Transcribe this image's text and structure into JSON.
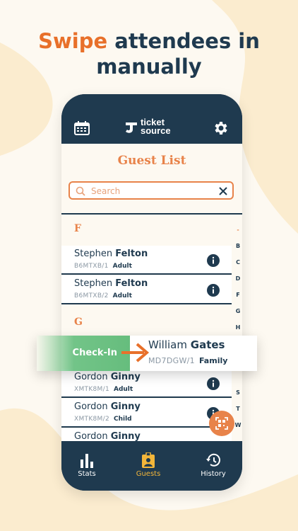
{
  "headline": {
    "accent": "Swipe",
    "rest": "attendees in",
    "line2": "manually"
  },
  "header": {
    "logo_line1": "ticket",
    "logo_line2": "source",
    "calendar_icon": "calendar-icon",
    "settings_icon": "gear-icon"
  },
  "screen": {
    "title": "Guest List"
  },
  "search": {
    "placeholder": "Search"
  },
  "sections": [
    {
      "letter": "F",
      "rows": [
        {
          "first": "Stephen",
          "last": "Felton",
          "code": "B6MTXB/1",
          "type": "Adult"
        },
        {
          "first": "Stephen",
          "last": "Felton",
          "code": "B6MTXB/2",
          "type": "Adult"
        }
      ]
    },
    {
      "letter": "G",
      "rows": [
        {
          "first": "Gordon",
          "last": "Ginny",
          "code": "XMTK8M/1",
          "type": "Adult"
        },
        {
          "first": "Gordon",
          "last": "Ginny",
          "code": "XMTK8M/2",
          "type": "Child"
        },
        {
          "first": "Gordon",
          "last": "Ginny",
          "code": "",
          "type": ""
        }
      ]
    }
  ],
  "alphabet": [
    "-",
    "B",
    "C",
    "D",
    "F",
    "G",
    "H",
    "",
    "",
    "",
    "S",
    "T",
    "W"
  ],
  "swipe": {
    "action_label": "Check-In",
    "first": "William",
    "last": "Gates",
    "code": "MD7DGW/1",
    "type": "Family"
  },
  "nav": [
    {
      "label": "Stats",
      "icon": "bar-chart-icon",
      "active": false
    },
    {
      "label": "Guests",
      "icon": "badge-icon",
      "active": true
    },
    {
      "label": "History",
      "icon": "history-icon",
      "active": false
    }
  ],
  "colors": {
    "navy": "#1f3a4f",
    "orange": "#e8834a",
    "green": "#72c488",
    "active_nav": "#f3b63a",
    "background": "#fdf9f1"
  }
}
